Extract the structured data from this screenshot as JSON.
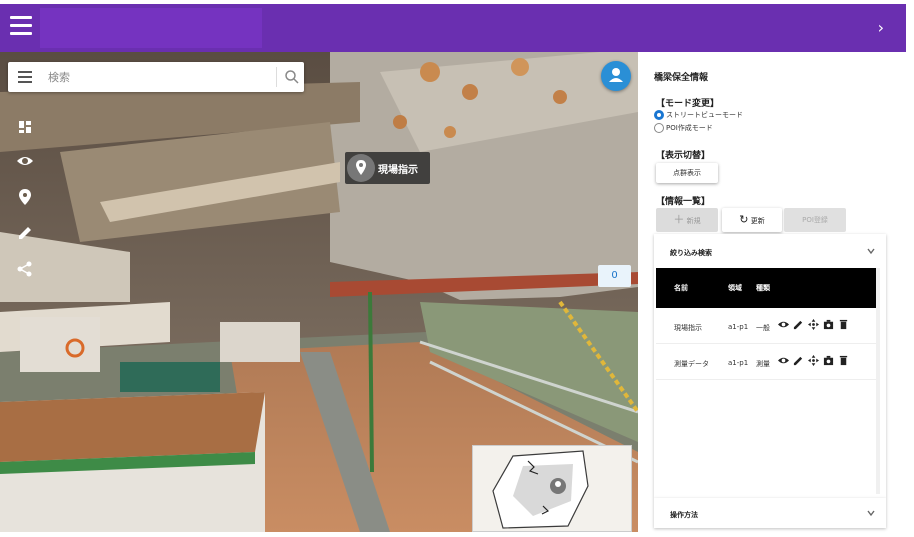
{
  "header": {
    "menu_icon": "hamburger-icon",
    "collapse_icon": "chevron-right-icon",
    "bar_color": "#6a2fb0"
  },
  "search": {
    "placeholder": "検索",
    "menu_icon": "menu-icon",
    "search_icon": "search-icon"
  },
  "avatar": {
    "icon": "person-icon",
    "color": "#2a8fd6"
  },
  "toolbar": {
    "items": [
      "dashboard-icon",
      "eye-icon",
      "location-pin-icon",
      "pencil-icon",
      "share-icon"
    ]
  },
  "poi": {
    "label": "現場指示"
  },
  "viewer": {
    "badge_value": "0"
  },
  "panel": {
    "title": "橋梁保全情報",
    "mode_section": "【モード変更】",
    "mode_options": [
      "ストリートビューモード",
      "POI作成モード"
    ],
    "display_section": "【表示切替】",
    "display_button": "点群表示",
    "info_section": "【情報一覧】",
    "buttons": {
      "add": "新規",
      "update": "更新",
      "register": "POI登録"
    },
    "filter_title": "絞り込み検索",
    "table": {
      "headers": [
        "名前",
        "領域",
        "種類"
      ],
      "rows": [
        {
          "name": "現場指示",
          "area": "a1-p1",
          "type": "一般"
        },
        {
          "name": "測量データ",
          "area": "a1-p1",
          "type": "測量"
        }
      ]
    },
    "manual_title": "操作方法"
  }
}
